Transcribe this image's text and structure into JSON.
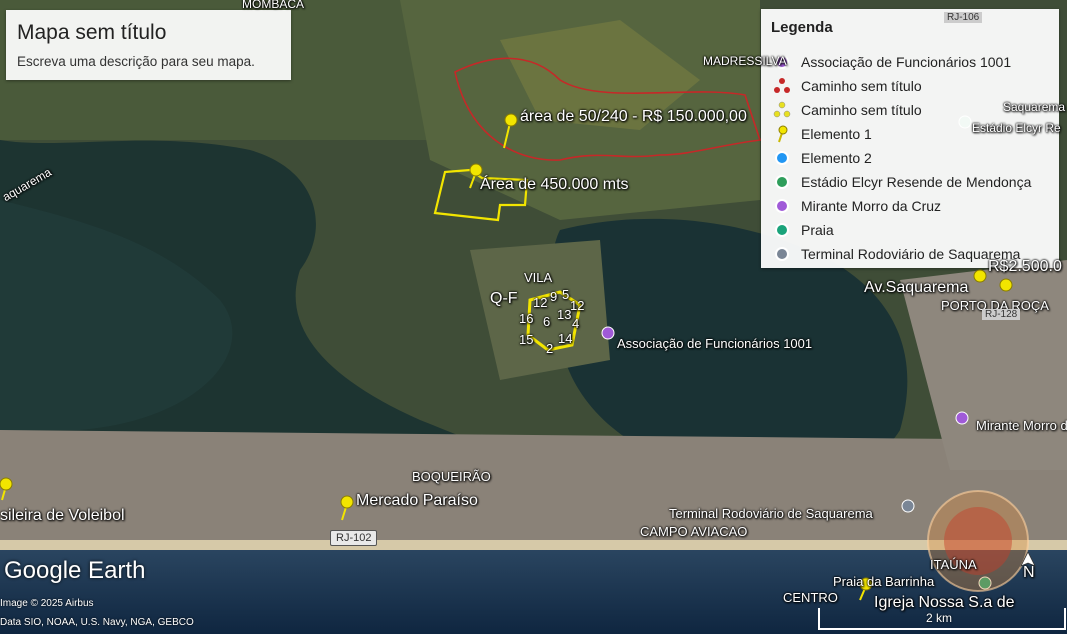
{
  "title_card": {
    "title": "Mapa sem título",
    "description": "Escreva uma descrição para seu mapa."
  },
  "legend": {
    "heading": "Legenda",
    "items": [
      {
        "label": "Associação de Funcionários 1001",
        "icon": "purple-place-icon",
        "color": "#a05ad8"
      },
      {
        "label": "Caminho sem título",
        "icon": "red-path-icon",
        "color": "#c62828"
      },
      {
        "label": "Caminho sem título",
        "icon": "yellow-path-icon",
        "color": "#e8e020"
      },
      {
        "label": "Elemento 1",
        "icon": "yellow-pushpin-icon",
        "color": "#f2e500"
      },
      {
        "label": "Elemento 2",
        "icon": "blue-place-icon",
        "color": "#2196f3"
      },
      {
        "label": "Estádio Elcyr Resende de Mendonça",
        "icon": "green-stadium-icon",
        "color": "#2e9e5b"
      },
      {
        "label": "Mirante Morro da Cruz",
        "icon": "purple-place-icon",
        "color": "#a05ad8"
      },
      {
        "label": "Praia",
        "icon": "teal-beach-icon",
        "color": "#1aa37a"
      },
      {
        "label": "Terminal Rodoviário de Saquarema",
        "icon": "gray-bus-icon",
        "color": "#7a8696"
      }
    ]
  },
  "map_labels": {
    "mombaca": "MOMBACA",
    "madressilva": "MADRESSILVA",
    "saquarema_top": "Saquarema",
    "saquarema_left": "aquarema",
    "area_50": "área de 50/240 - R$ 150.000,00",
    "area_450": "Área de 450.000 mts",
    "vila": "VILA",
    "qf": "Q-F",
    "assoc": "Associação de Funcionários 1001",
    "r_price": "R$2.500.0",
    "av_saquarema": "Av.Saquarema",
    "porto_da_roca": "PORTO DA ROÇA",
    "rj128": "RJ-128",
    "mirante": "Mirante Morro d",
    "boqueirao": "BOQUEIRÃO",
    "mercado": "Mercado Paraíso",
    "volei": "sileira de Voleibol",
    "terminal": "Terminal Rodoviário de Saquarema",
    "campo": "CAMPO AVIACAO",
    "praia_barrinha": "Praia da Barrinha",
    "itauna": "ITAÚNA",
    "centro": "CENTRO",
    "igreja": "Igreja Nossa S.a de",
    "rj102": "RJ-102",
    "rj106": "RJ-106",
    "estadio_label": "Estádio Elcyr Re",
    "numbers": [
      "12",
      "9",
      "5",
      "12",
      "16",
      "6",
      "13",
      "4",
      "15",
      "2",
      "14"
    ]
  },
  "footer": {
    "logo": "Google Earth",
    "image_credit": "Image © 2025 Airbus",
    "data_credit": "Data SIO, NOAA, U.S. Navy, NGA, GEBCO",
    "scale": "2 km",
    "north": "N"
  }
}
